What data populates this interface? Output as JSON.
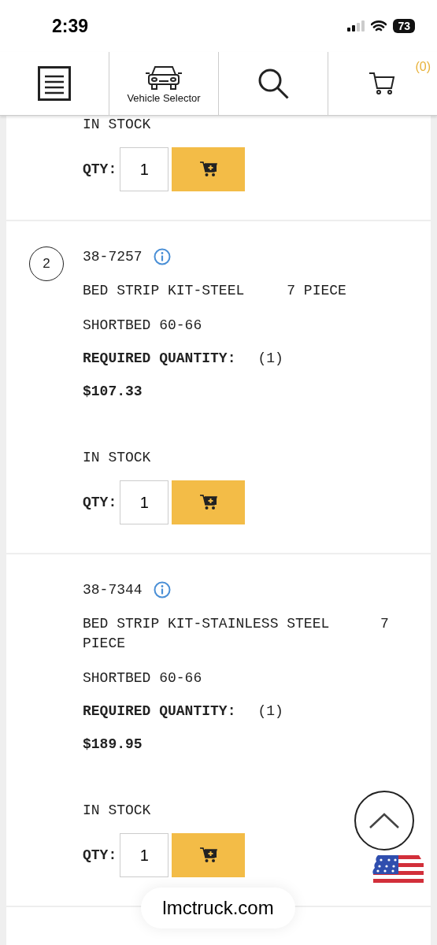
{
  "status_bar": {
    "time": "2:39",
    "battery": "73"
  },
  "header": {
    "items": [
      {
        "kind": "menu"
      },
      {
        "kind": "vehicle",
        "label": "Vehicle Selector"
      },
      {
        "kind": "search"
      },
      {
        "kind": "cart",
        "count": "(0)"
      }
    ]
  },
  "products": [
    {
      "stock": "IN STOCK",
      "qty_label": "QTY:",
      "qty": "1"
    },
    {
      "number": "2",
      "part_number": "38-7257",
      "description": "BED STRIP KIT-STEEL     7 PIECE",
      "fitment": "SHORTBED 60-66",
      "required_label": "REQUIRED QUANTITY:",
      "required_value": "(1)",
      "price": "$107.33",
      "stock": "IN STOCK",
      "qty_label": "QTY:",
      "qty": "1"
    },
    {
      "part_number": "38-7344",
      "description": "BED STRIP KIT-STAINLESS STEEL      7 PIECE",
      "fitment": "SHORTBED 60-66",
      "required_label": "REQUIRED QUANTITY:",
      "required_value": "(1)",
      "price": "$189.95",
      "stock": "IN STOCK",
      "qty_label": "QTY:",
      "qty": "1"
    }
  ],
  "url_bar": {
    "domain": "lmctruck.com"
  }
}
